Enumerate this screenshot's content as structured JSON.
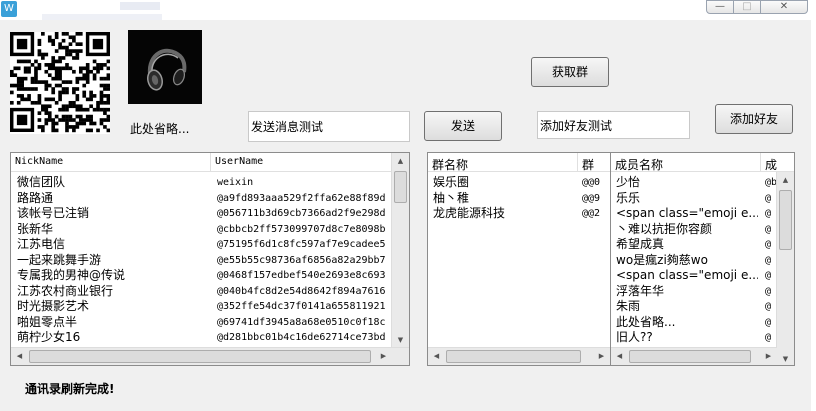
{
  "window": {
    "min_glyph": "—",
    "max_glyph": "□",
    "close_glyph": "✕"
  },
  "labels": {
    "omitted": "此处省略...",
    "status": "通讯录刷新完成!"
  },
  "inputs": {
    "message_value": "发送消息测试",
    "friend_value": "添加好友测试"
  },
  "buttons": {
    "get_groups": "获取群",
    "send": "发送",
    "add_friend": "添加好友"
  },
  "contacts": {
    "columns": [
      "NickName",
      "UserName"
    ],
    "rows": [
      [
        "微信团队",
        "weixin"
      ],
      [
        "路路通",
        "@a9fd893aaa529f2ffa62e88f89d"
      ],
      [
        "该帐号已注销",
        "@056711b3d69cb7366ad2f9e298d"
      ],
      [
        "张新华",
        "@cbbcb2ff573099707d8c7e8098b"
      ],
      [
        "江苏电信",
        "@75195f6d1c8fc597af7e9cadee5"
      ],
      [
        "一起来跳舞手游",
        "@e55b55c98736af6856a82a29bb7"
      ],
      [
        "专属我的男神@传说",
        "@0468f157edbef540e2693e8c693"
      ],
      [
        "江苏农村商业银行",
        "@040b4fc8d2e54d8642f894a7616"
      ],
      [
        "时光摄影艺术",
        "@352ffe54dc37f0141a655811921"
      ],
      [
        "啪姐零点半",
        "@69741df3945a8a68e0510c0f18c"
      ],
      [
        "萌柠少女16",
        "@d281bbc01b4c16de62714ce73bd"
      ]
    ]
  },
  "groups": {
    "columns": [
      "群名称",
      "群_"
    ],
    "rows": [
      [
        "娱乐圈",
        "@@0"
      ],
      [
        "柚丶稚",
        "@@9"
      ],
      [
        "龙虎能源科技",
        "@@2"
      ]
    ]
  },
  "members": {
    "columns": [
      "成员名称",
      "成"
    ],
    "rows": [
      [
        "少怡",
        "@b"
      ],
      [
        "乐乐",
        "@"
      ],
      [
        "<span class=\"emoji e...",
        "@"
      ],
      [
        "丶难以抗拒你容颜",
        "@"
      ],
      [
        "希望成真",
        "@"
      ],
      [
        "wo是瘋zi夠慈wo",
        "@"
      ],
      [
        "<span class=\"emoji e...",
        "@"
      ],
      [
        "浮落年华",
        "@"
      ],
      [
        "朱雨",
        "@"
      ],
      [
        "此处省略...",
        "@"
      ],
      [
        "旧人??",
        "@"
      ]
    ]
  },
  "colors": {
    "window_bg": "#f0f0f0",
    "panel_border": "#8c8c8c"
  }
}
